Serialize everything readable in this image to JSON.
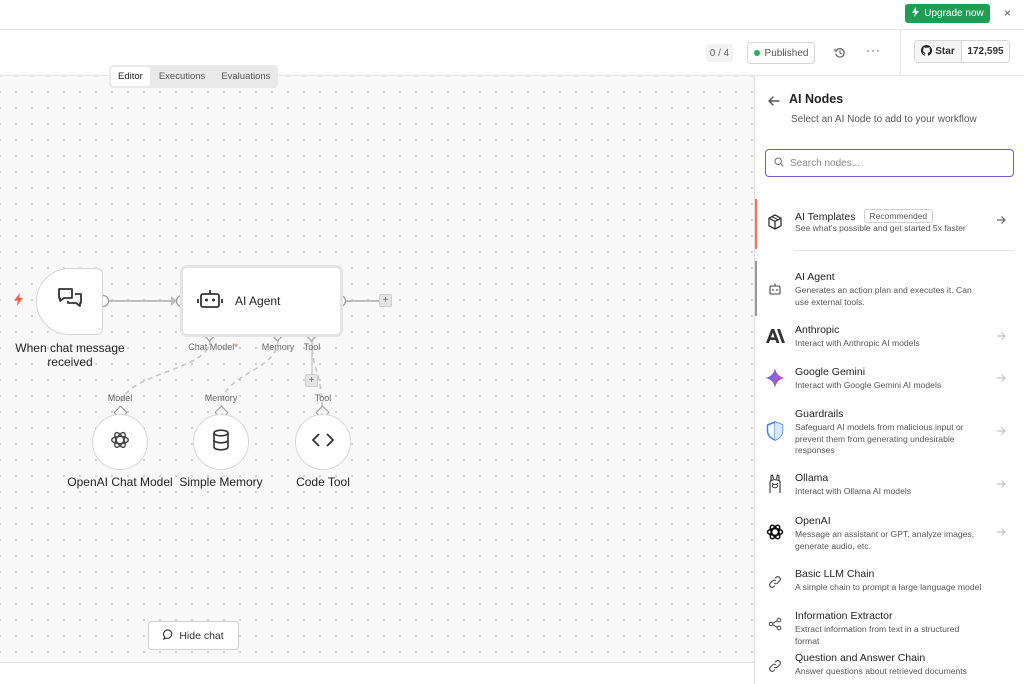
{
  "banner": {
    "upgrade_label": "Upgrade now",
    "close_glyph": "×"
  },
  "header": {
    "counter": "0 / 4",
    "published_label": "Published",
    "more_glyph": "···",
    "github_star_label": "Star",
    "github_star_count": "172,595"
  },
  "canvas": {
    "tabs": [
      {
        "label": "Editor",
        "active": true
      },
      {
        "label": "Executions",
        "active": false
      },
      {
        "label": "Evaluations",
        "active": false
      }
    ],
    "trigger_label": "When chat message received",
    "agent_label": "AI Agent",
    "agent_ports": {
      "chat_model": "Chat Model",
      "required_mark": "*",
      "memory": "Memory",
      "tool": "Tool"
    },
    "sub_nodes": [
      {
        "port_label": "Model",
        "label": "OpenAI Chat Model",
        "icon": "openai-icon"
      },
      {
        "port_label": "Memory",
        "label": "Simple Memory",
        "icon": "database-icon"
      },
      {
        "port_label": "Tool",
        "label": "Code Tool",
        "icon": "code-icon"
      }
    ],
    "plus_glyph": "+",
    "hide_chat_label": "Hide chat"
  },
  "panel": {
    "title": "AI Nodes",
    "subtitle": "Select an AI Node to add to your workflow",
    "search_placeholder": "Search nodes...",
    "templates": {
      "title": "AI Templates",
      "badge": "Recommended",
      "desc": "See what's possible and get started 5x faster"
    },
    "items": [
      {
        "title": "AI Agent",
        "desc": "Generates an action plan and executes it. Can use external tools.",
        "icon": "robot-icon"
      },
      {
        "title": "Anthropic",
        "desc": "Interact with Anthropic AI models",
        "icon": "anthropic-icon"
      },
      {
        "title": "Google Gemini",
        "desc": "Interact with Google Gemini AI models",
        "icon": "gemini-icon"
      },
      {
        "title": "Guardrails",
        "desc": "Safeguard AI models from malicious input or prevent them from generating undesirable responses",
        "icon": "shield-icon"
      },
      {
        "title": "Ollama",
        "desc": "Interact with Ollama AI models",
        "icon": "ollama-icon"
      },
      {
        "title": "OpenAI",
        "desc": "Message an assistant or GPT, analyze images, generate audio, etc.",
        "icon": "openai-icon"
      },
      {
        "title": "Basic LLM Chain",
        "desc": "A simple chain to prompt a large language model",
        "icon": "link-icon"
      },
      {
        "title": "Information Extractor",
        "desc": "Extract information from text in a structured format",
        "icon": "extractor-icon"
      },
      {
        "title": "Question and Answer Chain",
        "desc": "Answer questions about retrieved documents",
        "icon": "link-icon"
      }
    ]
  },
  "colors": {
    "accent": "#1f9d55",
    "focus": "#6b5fc4",
    "template_accent": "#ff6b57"
  }
}
